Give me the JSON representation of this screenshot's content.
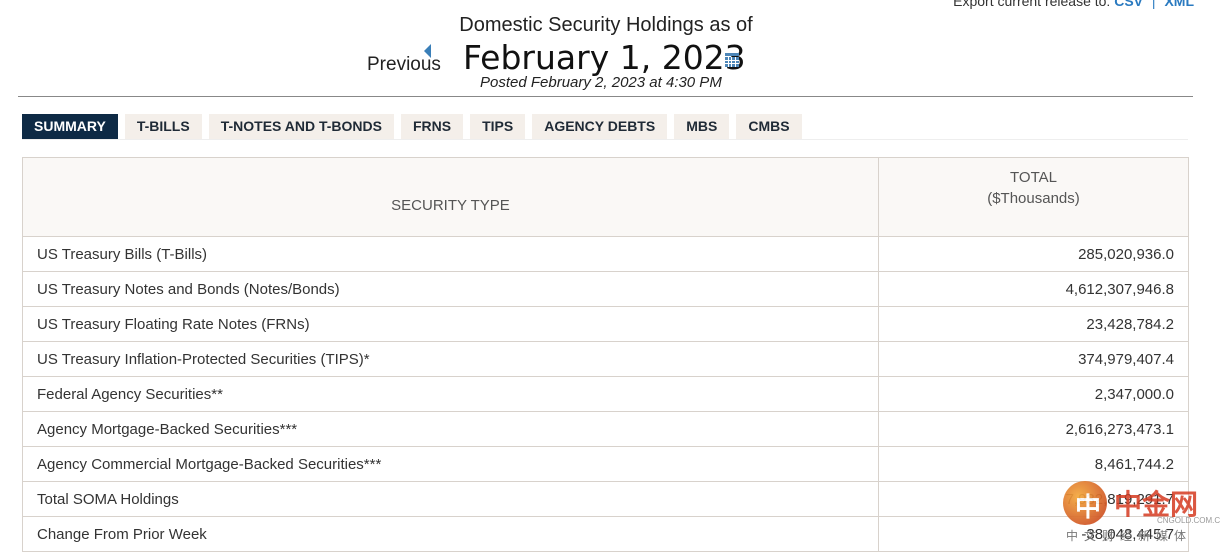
{
  "export": {
    "label": "Export current release to:",
    "csv": "CSV",
    "xml": "XML"
  },
  "header": {
    "title": "Domestic Security Holdings as of",
    "previous_label": "Previous",
    "date": "February 1, 2023",
    "posted": "Posted February 2, 2023 at 4:30 PM"
  },
  "tabs": [
    {
      "label": "SUMMARY",
      "active": true
    },
    {
      "label": "T-BILLS",
      "active": false
    },
    {
      "label": "T-NOTES AND T-BONDS",
      "active": false
    },
    {
      "label": "FRNS",
      "active": false
    },
    {
      "label": "TIPS",
      "active": false
    },
    {
      "label": "AGENCY DEBTS",
      "active": false
    },
    {
      "label": "MBS",
      "active": false
    },
    {
      "label": "CMBS",
      "active": false
    }
  ],
  "table": {
    "col_type": "SECURITY TYPE",
    "col_total_line1": "TOTAL",
    "col_total_line2": "($Thousands)",
    "rows": [
      {
        "type": "US Treasury Bills (T-Bills)",
        "total": "285,020,936.0"
      },
      {
        "type": "US Treasury Notes and Bonds (Notes/Bonds)",
        "total": "4,612,307,946.8"
      },
      {
        "type": "US Treasury Floating Rate Notes (FRNs)",
        "total": "23,428,784.2"
      },
      {
        "type": "US Treasury Inflation-Protected Securities (TIPS)*",
        "total": "374,979,407.4"
      },
      {
        "type": "Federal Agency Securities**",
        "total": "2,347,000.0"
      },
      {
        "type": "Agency Mortgage-Backed Securities***",
        "total": "2,616,273,473.1"
      },
      {
        "type": "Agency Commercial Mortgage-Backed Securities***",
        "total": "8,461,744.2"
      },
      {
        "type": "Total SOMA Holdings",
        "total": "7,932,819,291.7"
      },
      {
        "type": "Change From Prior Week",
        "total": "-38,048,445.7"
      }
    ]
  },
  "watermark": {
    "logo_char": "中",
    "name": "中金网",
    "domain": "CNGOLD.COM.CN",
    "sub": "中文财经新媒体"
  },
  "colors": {
    "tab_active_bg": "#0e2a45",
    "tab_bg": "#f4efea",
    "link": "#2a7ac0"
  }
}
